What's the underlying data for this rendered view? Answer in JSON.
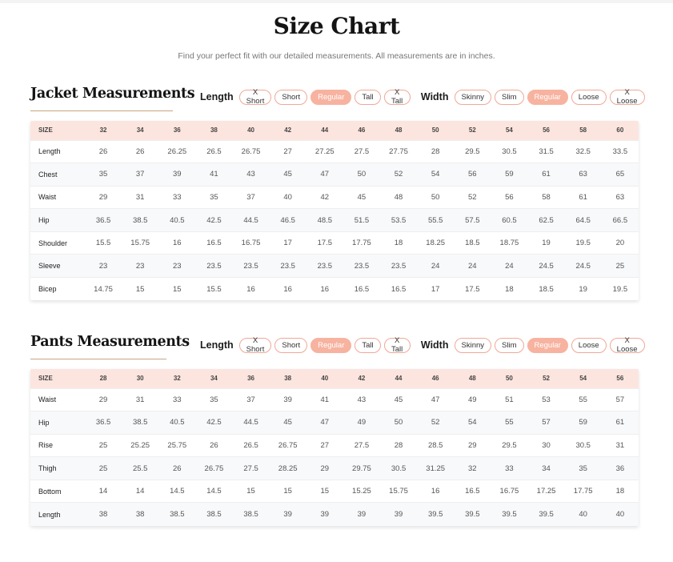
{
  "header": {
    "title": "Size Chart",
    "subtitle": "Find your perfect fit with our detailed measurements. All measurements are in inches."
  },
  "filters": {
    "length_label": "Length",
    "width_label": "Width",
    "length_options": [
      "X Short",
      "Short",
      "Regular",
      "Tall",
      "X Tall"
    ],
    "width_options": [
      "Skinny",
      "Slim",
      "Regular",
      "Loose",
      "X Loose"
    ],
    "selected_length": "Regular",
    "selected_width": "Regular"
  },
  "jacket": {
    "title": "Jacket Measurements",
    "size_label": "SIZE",
    "sizes": [
      "32",
      "34",
      "36",
      "38",
      "40",
      "42",
      "44",
      "46",
      "48",
      "50",
      "52",
      "54",
      "56",
      "58",
      "60"
    ],
    "rows": [
      {
        "label": "Length",
        "values": [
          "26",
          "26",
          "26.25",
          "26.5",
          "26.75",
          "27",
          "27.25",
          "27.5",
          "27.75",
          "28",
          "29.5",
          "30.5",
          "31.5",
          "32.5",
          "33.5"
        ]
      },
      {
        "label": "Chest",
        "values": [
          "35",
          "37",
          "39",
          "41",
          "43",
          "45",
          "47",
          "50",
          "52",
          "54",
          "56",
          "59",
          "61",
          "63",
          "65"
        ]
      },
      {
        "label": "Waist",
        "values": [
          "29",
          "31",
          "33",
          "35",
          "37",
          "40",
          "42",
          "45",
          "48",
          "50",
          "52",
          "56",
          "58",
          "61",
          "63"
        ]
      },
      {
        "label": "Hip",
        "values": [
          "36.5",
          "38.5",
          "40.5",
          "42.5",
          "44.5",
          "46.5",
          "48.5",
          "51.5",
          "53.5",
          "55.5",
          "57.5",
          "60.5",
          "62.5",
          "64.5",
          "66.5"
        ]
      },
      {
        "label": "Shoulder",
        "values": [
          "15.5",
          "15.75",
          "16",
          "16.5",
          "16.75",
          "17",
          "17.5",
          "17.75",
          "18",
          "18.25",
          "18.5",
          "18.75",
          "19",
          "19.5",
          "20"
        ]
      },
      {
        "label": "Sleeve",
        "values": [
          "23",
          "23",
          "23",
          "23.5",
          "23.5",
          "23.5",
          "23.5",
          "23.5",
          "23.5",
          "24",
          "24",
          "24",
          "24.5",
          "24.5",
          "25"
        ]
      },
      {
        "label": "Bicep",
        "values": [
          "14.75",
          "15",
          "15",
          "15.5",
          "16",
          "16",
          "16",
          "16.5",
          "16.5",
          "17",
          "17.5",
          "18",
          "18.5",
          "19",
          "19.5"
        ]
      }
    ]
  },
  "pants": {
    "title": "Pants Measurements",
    "size_label": "SIZE",
    "sizes": [
      "28",
      "30",
      "32",
      "34",
      "36",
      "38",
      "40",
      "42",
      "44",
      "46",
      "48",
      "50",
      "52",
      "54",
      "56"
    ],
    "rows": [
      {
        "label": "Waist",
        "values": [
          "29",
          "31",
          "33",
          "35",
          "37",
          "39",
          "41",
          "43",
          "45",
          "47",
          "49",
          "51",
          "53",
          "55",
          "57"
        ]
      },
      {
        "label": "Hip",
        "values": [
          "36.5",
          "38.5",
          "40.5",
          "42.5",
          "44.5",
          "45",
          "47",
          "49",
          "50",
          "52",
          "54",
          "55",
          "57",
          "59",
          "61"
        ]
      },
      {
        "label": "Rise",
        "values": [
          "25",
          "25.25",
          "25.75",
          "26",
          "26.5",
          "26.75",
          "27",
          "27.5",
          "28",
          "28.5",
          "29",
          "29.5",
          "30",
          "30.5",
          "31"
        ]
      },
      {
        "label": "Thigh",
        "values": [
          "25",
          "25.5",
          "26",
          "26.75",
          "27.5",
          "28.25",
          "29",
          "29.75",
          "30.5",
          "31.25",
          "32",
          "33",
          "34",
          "35",
          "36"
        ]
      },
      {
        "label": "Bottom",
        "values": [
          "14",
          "14",
          "14.5",
          "14.5",
          "15",
          "15",
          "15",
          "15.25",
          "15.75",
          "16",
          "16.5",
          "16.75",
          "17.25",
          "17.75",
          "18"
        ]
      },
      {
        "label": "Length",
        "values": [
          "38",
          "38",
          "38.5",
          "38.5",
          "38.5",
          "39",
          "39",
          "39",
          "39",
          "39.5",
          "39.5",
          "39.5",
          "39.5",
          "40",
          "40"
        ]
      }
    ]
  },
  "colors": {
    "accent": "#f7b3a0",
    "pill_border": "#f0a896",
    "table_header_bg": "#fde5df",
    "title_rule": "#c8a582"
  }
}
